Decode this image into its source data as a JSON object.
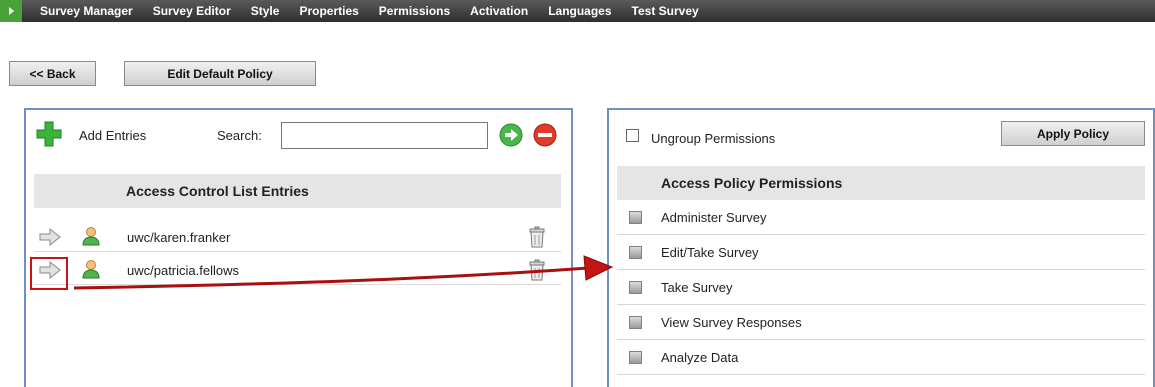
{
  "nav": {
    "items": [
      "Survey Manager",
      "Survey Editor",
      "Style",
      "Properties",
      "Permissions",
      "Activation",
      "Languages",
      "Test Survey"
    ]
  },
  "buttons": {
    "back": "<< Back",
    "edit_default_policy": "Edit Default Policy",
    "apply_policy": "Apply Policy"
  },
  "acl_panel": {
    "add_entries": "Add Entries",
    "search_label": "Search:",
    "search_value": "",
    "header": "Access Control List Entries",
    "entries": [
      "uwc/karen.franker",
      "uwc/patricia.fellows"
    ]
  },
  "policy_panel": {
    "ungroup_label": "Ungroup Permissions",
    "header": "Access Policy Permissions",
    "permissions": [
      "Administer Survey",
      "Edit/Take Survey",
      "Take Survey",
      "View Survey Responses",
      "Analyze Data"
    ]
  },
  "colors": {
    "nav_bg": "#3a3a3a",
    "panel_border": "#6f8fc6",
    "header_bg": "#e5e5e5",
    "annotation_red": "#cc1111"
  },
  "icons": {
    "add": "plus-icon",
    "go": "go-arrow-icon",
    "clear": "minus-icon",
    "move": "right-arrow-icon",
    "user": "user-icon",
    "delete": "trash-icon"
  }
}
